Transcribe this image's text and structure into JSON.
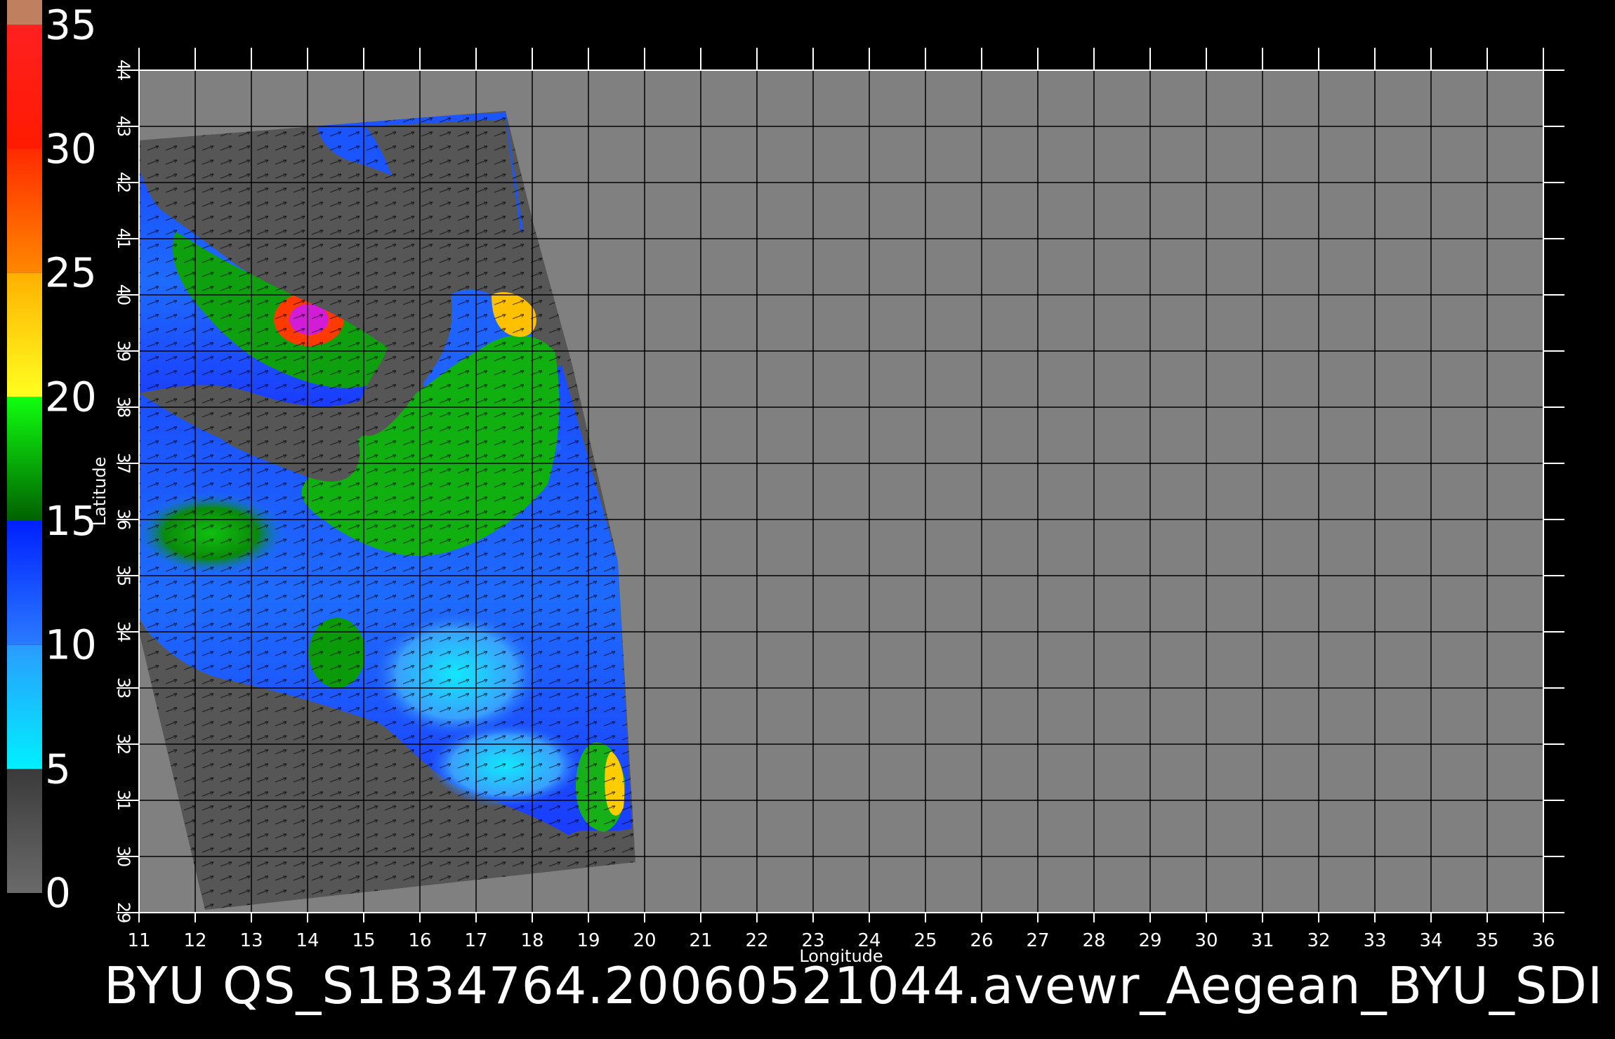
{
  "product_title": "BYU QS_S1B34764.20060521044.avewr_Aegean_BYU_SDI",
  "axes": {
    "x_label": "Longitude",
    "y_label": "Latitude",
    "x_ticks": [
      "11",
      "12",
      "13",
      "14",
      "15",
      "16",
      "17",
      "18",
      "19",
      "20",
      "21",
      "22",
      "23",
      "24",
      "25",
      "26",
      "27",
      "28",
      "29",
      "30",
      "31",
      "32",
      "33",
      "34",
      "35",
      "36"
    ],
    "y_ticks": [
      "29",
      "30",
      "31",
      "32",
      "33",
      "34",
      "35",
      "36",
      "37",
      "38",
      "39",
      "40",
      "41",
      "42",
      "43",
      "44"
    ]
  },
  "colorbar": {
    "ticks": [
      "35",
      "30",
      "25",
      "20",
      "15",
      "10",
      "5",
      "0"
    ],
    "bands": [
      {
        "from": 0,
        "to": 5,
        "colors": [
          "#6a6a6a",
          "#3a3a3a"
        ]
      },
      {
        "from": 5,
        "to": 10,
        "colors": [
          "#00f0ff",
          "#2a9bff"
        ]
      },
      {
        "from": 10,
        "to": 15,
        "colors": [
          "#2a7bff",
          "#0020ff"
        ]
      },
      {
        "from": 15,
        "to": 20,
        "colors": [
          "#006000",
          "#10ff10"
        ]
      },
      {
        "from": 20,
        "to": 25,
        "colors": [
          "#ffff20",
          "#ffb000"
        ]
      },
      {
        "from": 25,
        "to": 30,
        "colors": [
          "#ff8800",
          "#ff2a00"
        ]
      },
      {
        "from": 30,
        "to": 35,
        "colors": [
          "#ff1a00",
          "#ff2020"
        ]
      },
      {
        "from": 35,
        "to": 36,
        "colors": [
          "#c08060",
          "#c08060"
        ]
      }
    ]
  },
  "colors": {
    "background": "#000000",
    "map_fill": "#808080",
    "swath_land": "#555555",
    "grid": "#000000",
    "text": "#ffffff"
  }
}
